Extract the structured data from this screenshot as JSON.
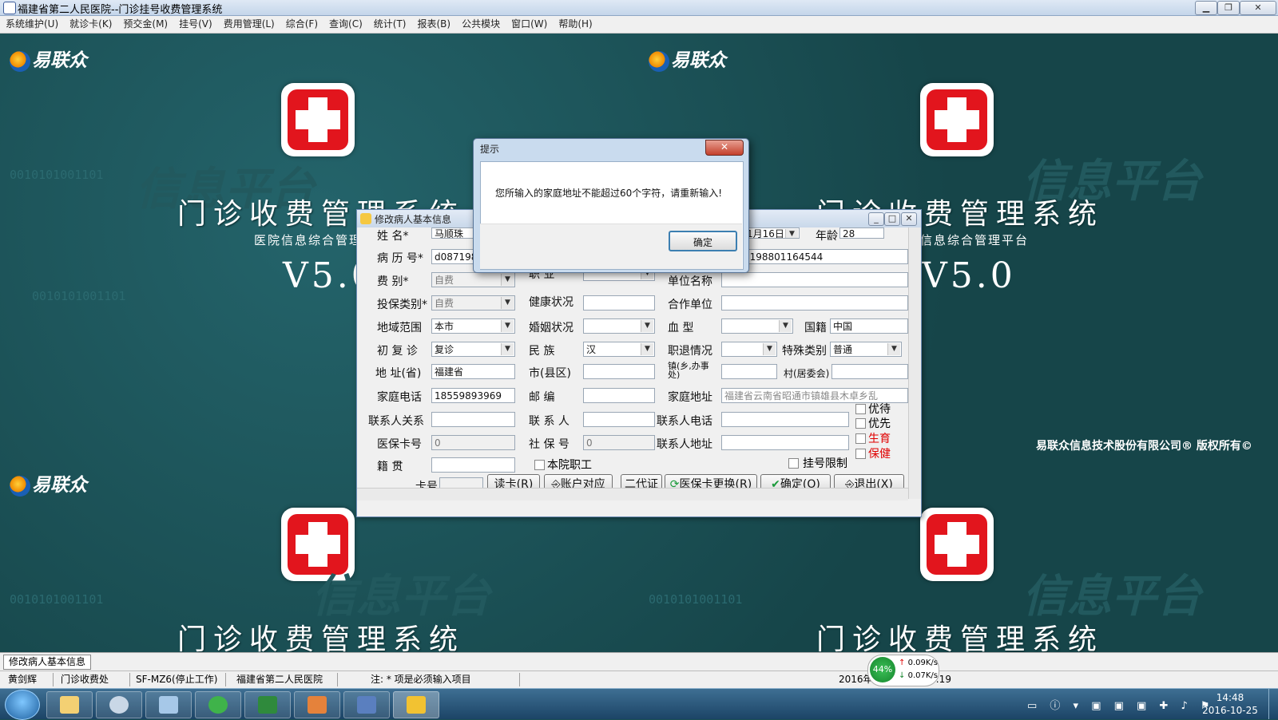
{
  "window": {
    "title": "福建省第二人民医院--门诊挂号收费管理系统"
  },
  "menu": [
    "系统维护(U)",
    "就诊卡(K)",
    "预交金(M)",
    "挂号(V)",
    "费用管理(L)",
    "综合(F)",
    "查询(C)",
    "统计(T)",
    "报表(B)",
    "公共模块",
    "窗口(W)",
    "帮助(H)"
  ],
  "background": {
    "logo": "易联众",
    "system_title": "门诊收费管理系统",
    "subtitle": "医院信息综合管理平台",
    "version": "V5.0",
    "copyright": "易联众信息技术股份有限公司® 版权所有©",
    "binary_text": "0010101001101",
    "watermark": "信息平台"
  },
  "form": {
    "title": "修改病人基本信息",
    "labels": {
      "name": "姓    名*",
      "age": "年龄",
      "record_no": "病 历 号*",
      "fee_type": "费    别*",
      "occupation": "职    业",
      "work_unit": "单位名称",
      "insurance_type": "投保类别*",
      "health": "健康状况",
      "coop_unit": "合作单位",
      "region": "地域范围",
      "marital": "婚姻状况",
      "blood": "血    型",
      "nationality": "国籍",
      "visit_type": "初 复 诊",
      "ethnicity": "民    族",
      "retire": "职退情况",
      "special": "特殊类别",
      "province": "地 址(省)",
      "city": "市(县区)",
      "town": "镇(乡,办事处)",
      "village": "村(居委会)",
      "home_phone": "家庭电话",
      "zip": "邮    编",
      "home_addr": "家庭地址",
      "contact_rel": "联系人关系",
      "contact": "联 系 人",
      "contact_phone": "联系人电话",
      "med_card": "医保卡号",
      "social_no": "社 保 号",
      "contact_addr": "联系人地址",
      "native": "籍    贯",
      "staff": "本院职工",
      "reg_limit": "挂号限制",
      "card_no": "卡号"
    },
    "values": {
      "name": "马顺珠",
      "birth": "1月16日",
      "age": "28",
      "record_no": "d0871988",
      "id_no": "3198801164544",
      "fee_type": "自费",
      "insurance_type": "自费",
      "region": "本市",
      "nationality": "中国",
      "visit_type": "复诊",
      "ethnicity": "汉",
      "special": "普通",
      "province": "福建省",
      "home_phone": "18559893969",
      "home_addr": "福建省云南省昭通市镇雄县木卓乡乱",
      "med_card": "0",
      "social_no": "0"
    },
    "checks": [
      "优待",
      "优先",
      "生育",
      "保健"
    ],
    "buttons": {
      "read_card": "读卡(R)",
      "account": "账户对应",
      "id2": "二代证",
      "replace_card": "医保卡更换(R)",
      "ok": "确定(O)",
      "exit": "退出(X)"
    }
  },
  "dialog": {
    "title": "提示",
    "message": "您所输入的家庭地址不能超过60个字符，请重新输入!",
    "ok": "确定"
  },
  "status": {
    "active_window": "修改病人基本信息",
    "user": "黄剑辉",
    "dept": "门诊收费处",
    "terminal": "SF-MZ6(停止工作)",
    "hospital": "福建省第二人民医院",
    "note": "注: * 项是必须输入项目",
    "datetime": "2016年",
    "time_tail": "3:19"
  },
  "network": {
    "percent": "44%",
    "up": "0.09K/s",
    "down": "0.07K/s"
  },
  "clock": {
    "time": "14:48",
    "date": "2016-10-25"
  },
  "colors": {
    "desktop": "#164549",
    "cross_red": "#e2151d",
    "required_red": "#e00000"
  }
}
